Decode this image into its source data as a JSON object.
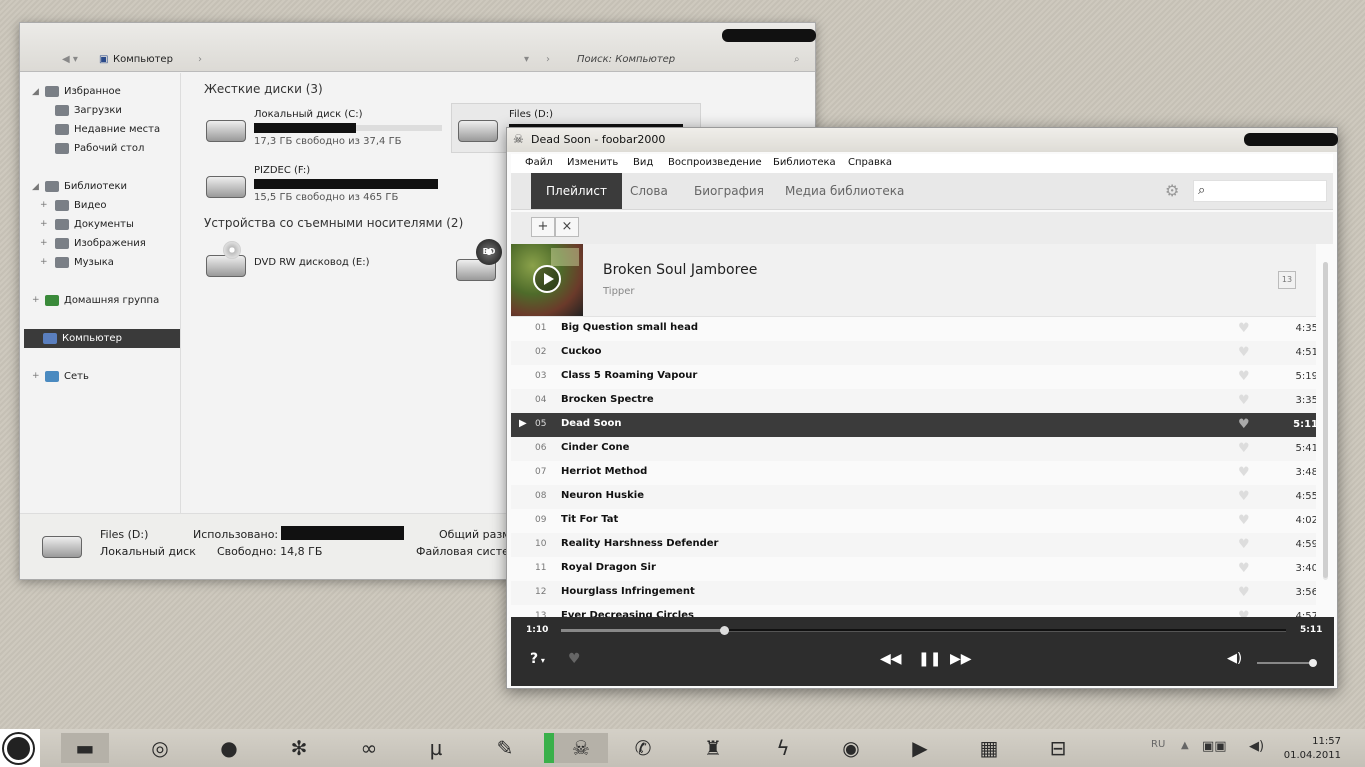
{
  "explorer": {
    "breadcrumb": "Компьютер",
    "search_placeholder": "Поиск: Компьютер",
    "nav": {
      "favorites": "Избранное",
      "downloads": "Загрузки",
      "recent": "Недавние места",
      "desktop": "Рабочий стол",
      "libraries": "Библиотеки",
      "videos": "Видео",
      "documents": "Документы",
      "images": "Изображения",
      "music": "Музыка",
      "homegroup": "Домашняя группа",
      "computer": "Компьютер",
      "network": "Сеть"
    },
    "hard_disks_header": "Жесткие диски (3)",
    "removable_header": "Устройства со съемными носителями (2)",
    "drives": [
      {
        "name": "Локальный диск (C:)",
        "info": "17,3 ГБ свободно из 37,4 ГБ",
        "used": 0.54
      },
      {
        "name": "Files (D:)",
        "info": "",
        "used": 0.91
      },
      {
        "name": "PIZDEC (F:)",
        "info": "15,5 ГБ свободно из 465 ГБ",
        "used": 0.97
      }
    ],
    "dvd": "DVD RW дисковод (E:)",
    "bd_label": "BD",
    "details": {
      "name": "Files (D:)",
      "type": "Локальный диск",
      "used_label": "Использовано:",
      "free_label": "Свободно: 14,8 ГБ",
      "total_label": "Общий разм",
      "fs_label": "Файловая систе"
    }
  },
  "foobar": {
    "title": "Dead Soon - foobar2000",
    "menu": [
      "Файл",
      "Изменить",
      "Вид",
      "Воспроизведение",
      "Библиотека",
      "Справка"
    ],
    "tabs": [
      "Плейлист",
      "Слова",
      "Биография",
      "Медиа библиотека"
    ],
    "album": {
      "title": "Broken Soul Jamboree",
      "artist": "Tipper",
      "count": "13"
    },
    "tracks": [
      {
        "num": "01",
        "title": "Big Question small head",
        "dur": "4:35"
      },
      {
        "num": "02",
        "title": "Cuckoo",
        "dur": "4:51"
      },
      {
        "num": "03",
        "title": "Class 5 Roaming Vapour",
        "dur": "5:19"
      },
      {
        "num": "04",
        "title": "Brocken Spectre",
        "dur": "3:35"
      },
      {
        "num": "05",
        "title": "Dead Soon",
        "dur": "5:11"
      },
      {
        "num": "06",
        "title": "Cinder Cone",
        "dur": "5:41"
      },
      {
        "num": "07",
        "title": "Herriot Method",
        "dur": "3:48"
      },
      {
        "num": "08",
        "title": "Neuron Huskie",
        "dur": "4:55"
      },
      {
        "num": "09",
        "title": "Tit For Tat",
        "dur": "4:02"
      },
      {
        "num": "10",
        "title": "Reality Harshness Defender",
        "dur": "4:59"
      },
      {
        "num": "11",
        "title": "Royal Dragon Sir",
        "dur": "3:40"
      },
      {
        "num": "12",
        "title": "Hourglass Infringement",
        "dur": "3:56"
      },
      {
        "num": "13",
        "title": "Ever Decreasing Circles",
        "dur": "4:57"
      }
    ],
    "selected_index": 4,
    "time_current": "1:10",
    "time_total": "5:11",
    "progress": 0.225,
    "volume": 1.0,
    "order_label": "?"
  },
  "taskbar": {
    "lang": "RU",
    "time": "11:57",
    "date": "01.04.2011",
    "icons": [
      "start-icon",
      "folder-icon",
      "chrome-icon",
      "skype-icon",
      "flower-icon",
      "share-icon",
      "utorrent-icon",
      "feather-icon",
      "foobar-icon",
      "wrench-icon",
      "brush-icon",
      "lightning-icon",
      "disc-icon",
      "play-icon",
      "chip-icon",
      "connector-icon"
    ]
  }
}
